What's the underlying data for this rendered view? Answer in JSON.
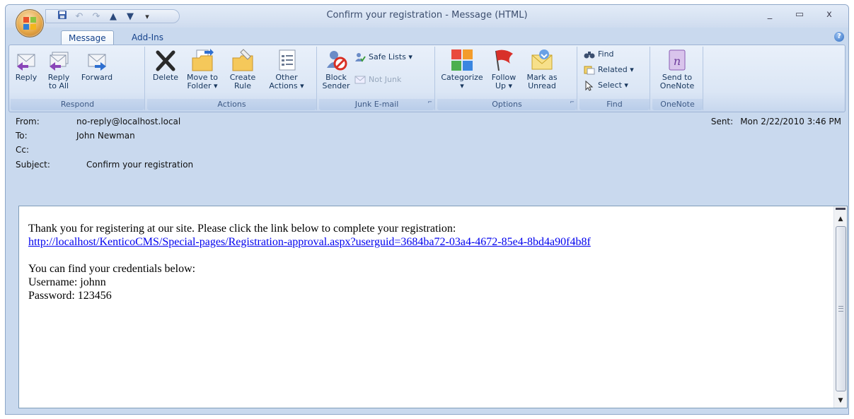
{
  "window": {
    "title": "Confirm your registration - Message (HTML)",
    "controls": {
      "minimize": "_",
      "maximize": "▭",
      "close": "x"
    }
  },
  "quick_access": [
    "save-icon",
    "undo-icon",
    "redo-icon",
    "previous-item-icon",
    "next-item-icon",
    "customize-qat-icon"
  ],
  "tabs": [
    {
      "label": "Message",
      "active": true
    },
    {
      "label": "Add-Ins",
      "active": false
    }
  ],
  "help": "?",
  "ribbon": {
    "respond": {
      "label": "Respond",
      "reply": {
        "line1": "Reply",
        "line2": ""
      },
      "reply_all": {
        "line1": "Reply",
        "line2": "to All"
      },
      "forward": {
        "line1": "Forward",
        "line2": ""
      }
    },
    "actions": {
      "label": "Actions",
      "delete": {
        "line1": "Delete",
        "line2": ""
      },
      "move": {
        "line1": "Move to",
        "line2": "Folder ▾"
      },
      "create_rule": {
        "line1": "Create",
        "line2": "Rule"
      },
      "other": {
        "line1": "Other",
        "line2": "Actions ▾"
      }
    },
    "junk": {
      "label": "Junk E-mail",
      "block": {
        "line1": "Block",
        "line2": "Sender"
      },
      "safe_lists": "Safe Lists ▾",
      "not_junk": "Not Junk"
    },
    "options": {
      "label": "Options",
      "categorize": {
        "line1": "Categorize",
        "line2": "▾"
      },
      "follow_up": {
        "line1": "Follow",
        "line2": "Up ▾"
      },
      "mark_unread": {
        "line1": "Mark as",
        "line2": "Unread"
      }
    },
    "find": {
      "label": "Find",
      "find": "Find",
      "related": "Related ▾",
      "select": "Select ▾"
    },
    "onenote": {
      "label": "OneNote",
      "send": {
        "line1": "Send to",
        "line2": "OneNote"
      }
    },
    "launcher_glyph": "⌐"
  },
  "header": {
    "from_label": "From:",
    "from_value": "no-reply@localhost.local",
    "to_label": "To:",
    "to_value": "John Newman",
    "cc_label": "Cc:",
    "cc_value": "",
    "subject_label": "Subject:",
    "subject_value": "Confirm your registration",
    "sent_label": "Sent:",
    "sent_value": "Mon 2/22/2010 3:46 PM"
  },
  "body": {
    "line1": "Thank you for registering at our site. Please click the link below to complete your registration:",
    "link": "http://localhost/KenticoCMS/Special-pages/Registration-approval.aspx?userguid=3684ba72-03a4-4672-85e4-8bd4a90f4b8f",
    "line3": "You can find your credentials below:",
    "line4": "Username: johnn",
    "line5": "Password: 123456"
  },
  "scrollbar": {
    "up": "▲",
    "down": "▼"
  }
}
